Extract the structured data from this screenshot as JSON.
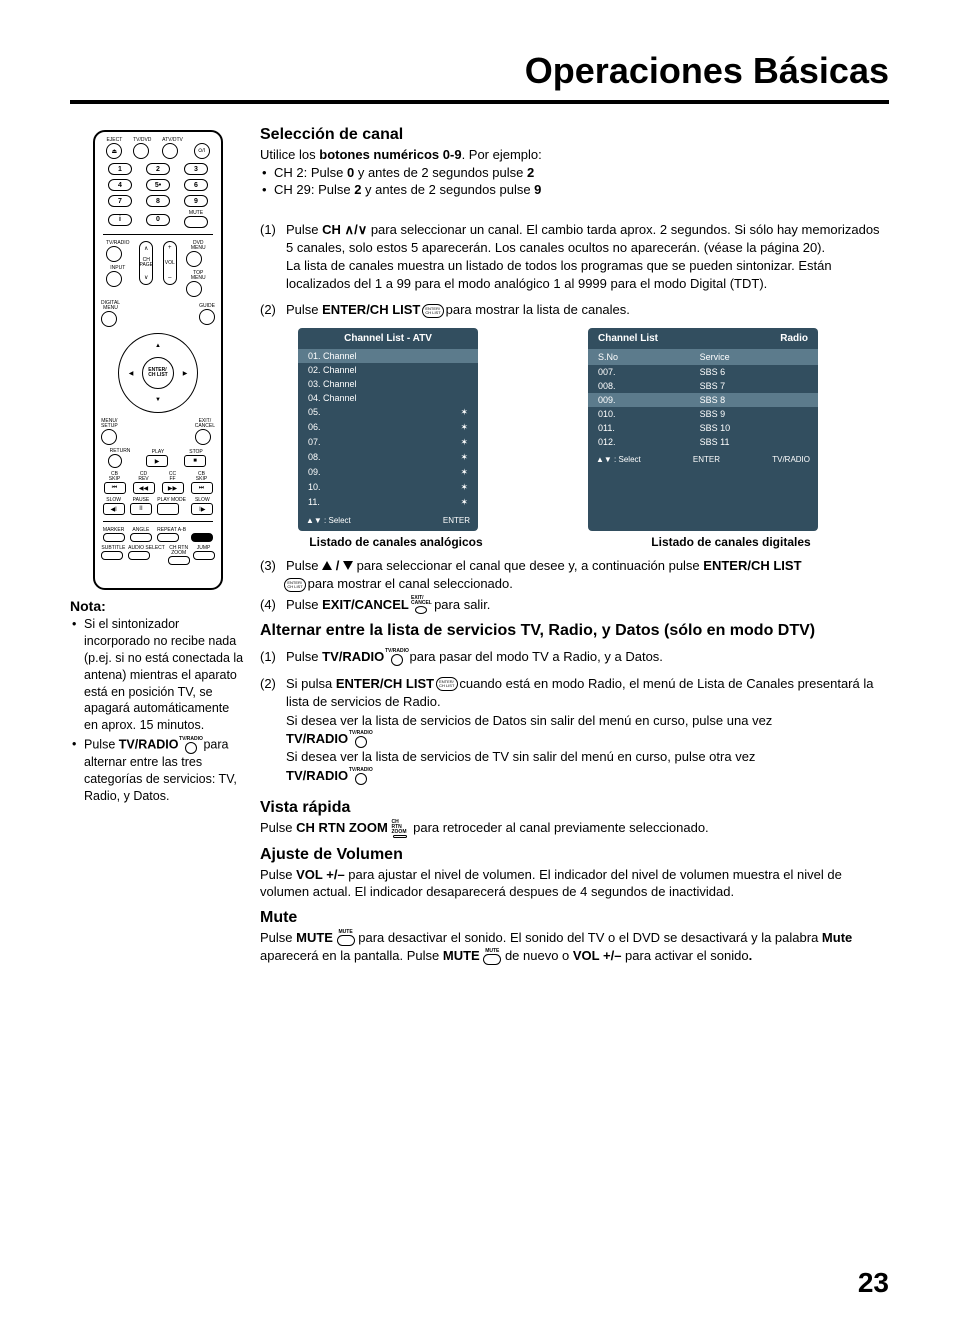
{
  "title": "Operaciones Básicas",
  "page_number": "23",
  "left": {
    "nota_heading": "Nota:",
    "notes": [
      "Si el sintonizador incorporado no recibe nada (p.ej. si no está conectada la antena) mientras el aparato está en posición TV, se apagará automáticamente en aprox. 15 minutos.",
      "Pulse TV/RADIO  para alternar entre las tres categorías de servicios: TV, Radio, y Datos."
    ],
    "note2_pre": "Pulse ",
    "note2_key": "TV/RADIO",
    "note2_post": " para alternar entre las tres categorías de servicios: TV, Radio, y Datos."
  },
  "remote": {
    "row_top_labels": [
      "EJECT",
      "TV/DVD",
      "ATV/DTV",
      ""
    ],
    "row_top_glyph": "⏏",
    "power_glyph": "⭘/I",
    "numbers": [
      "1",
      "2",
      "3",
      "4",
      "5•",
      "6",
      "7",
      "8",
      "9",
      "i",
      "0"
    ],
    "mute_label": "MUTE",
    "tvradio_label": "TV/RADIO",
    "dvdmenu_label": "DVD MENU",
    "input_label": "INPUT",
    "topmenu_label": "TOP MENU",
    "ch_page": "CH\nPAGE",
    "vol": "VOL",
    "digital_menu": "DIGITAL\nMENU",
    "guide": "GUIDE",
    "enter_chlist": "ENTER/\nCH LIST",
    "menu_setup": "MENU/\nSETUP",
    "exit_cancel": "EXIT/\nCANCEL",
    "return": "RETURN",
    "play": "PLAY",
    "stop": "STOP",
    "trick_row1": [
      "CB\nSKIP",
      "CD\nREV",
      "CC\nFF",
      "CB\nSKIP"
    ],
    "trick_row1_glyphs": [
      "⏮",
      "◀◀",
      "▶▶",
      "⏭"
    ],
    "trick_row2_labels": [
      "SLOW",
      "PAUSE",
      "PLAY MODE",
      "SLOW"
    ],
    "trick_row2_glyphs": [
      "◀I",
      "II",
      "",
      "I▶"
    ],
    "marker_row": [
      "MARKER",
      "ANGLE",
      "REPEAT A-B",
      ""
    ],
    "bottom_row": [
      "SUBTITLE",
      "AUDIO SELECT",
      "CH RTN\nZOOM",
      "JUMP"
    ]
  },
  "sec1": {
    "heading": "Selección de canal",
    "intro_pre": "Utilice los ",
    "intro_key": "botones numéricos 0-9",
    "intro_post": ". Por ejemplo:",
    "bullets": [
      "CH 2: Pulse 0 y antes de 2 segundos pulse 2",
      "CH 29: Pulse 2 y antes de 2 segundos pulse 9"
    ],
    "b1_pre": "CH 2: Pulse ",
    "b1_k1": "0",
    "b1_mid": " y antes de 2 segundos pulse ",
    "b1_k2": "2",
    "b2_pre": "CH 29: Pulse ",
    "b2_k1": "2",
    "b2_mid": " y antes de 2 segundos pulse ",
    "b2_k2": "9",
    "step1_num": "(1)",
    "step1_a": "Pulse ",
    "step1_key": "CH",
    "step1_b": " para seleccionar un canal. El cambio tarda aprox. 2 segundos. Si sólo hay memorizados 5 canales, solo estos 5 aparecerán. Los canales ocultos no aparecerán. (véase la página 20).",
    "step1_c": "La lista de canales muestra un listado de todos los programas que se pueden sintonizar. Están localizados del 1 a 99 para el modo analógico 1 al 9999 para el modo Digital (TDT).",
    "step2_num": "(2)",
    "step2_a": "Pulse ",
    "step2_key": "ENTER/CH LIST",
    "step2_b": " para mostrar la lista de canales.",
    "step3_num": "(3)",
    "step3_a": "Pulse ",
    "step3_mid": " para seleccionar el canal que desee y, a continuación pulse ",
    "step3_key2": "ENTER/CH LIST",
    "step3_c": " para mostrar el canal seleccionado.",
    "step4_num": "(4)",
    "step4_a": "Pulse ",
    "step4_key": "EXIT/CANCEL",
    "step4_b": " para salir."
  },
  "osd_analog": {
    "title": "Channel List - ATV",
    "rows": [
      "01. Channel",
      "02. Channel",
      "03. Channel",
      "04. Channel",
      "05.",
      "06.",
      "07.",
      "08.",
      "09.",
      "10.",
      "11."
    ],
    "highlight": 0,
    "footer_left": "▲▼ : Select",
    "footer_right": "ENTER",
    "caption": "Listado de canales analógicos"
  },
  "osd_digital": {
    "title_left": "Channel List",
    "title_right": "Radio",
    "th1": "S.No",
    "th2": "Service",
    "rows": [
      {
        "sno": "007.",
        "svc": "SBS 6"
      },
      {
        "sno": "008.",
        "svc": "SBS 7"
      },
      {
        "sno": "009.",
        "svc": "SBS 8"
      },
      {
        "sno": "010.",
        "svc": "SBS 9"
      },
      {
        "sno": "011.",
        "svc": "SBS 10"
      },
      {
        "sno": "012.",
        "svc": "SBS 11"
      }
    ],
    "highlight": 2,
    "footer_left": "▲▼ : Select",
    "footer_mid": "ENTER",
    "footer_right": "TV/RADIO",
    "caption": "Listado de canales digitales"
  },
  "sec2": {
    "heading": "Alternar entre la lista de servicios TV, Radio, y Datos (sólo en modo DTV)",
    "s1_num": "(1)",
    "s1_a": "Pulse ",
    "s1_key": "TV/RADIO",
    "s1_b": " para pasar del modo TV a Radio, y a Datos.",
    "s2_num": "(2)",
    "s2_a": "Si pulsa ",
    "s2_key": "ENTER/CH LIST",
    "s2_b": " cuando está en modo Radio, el menú de Lista de Canales presentará la lista de servicios de Radio.",
    "s2_c": "Si desea ver la lista de servicios de Datos sin salir del menú en curso, pulse una vez ",
    "s2_key2": "TV/RADIO",
    "s2_d": "Si desea ver la lista de servicios de TV sin salir del menú en curso, pulse otra vez ",
    "s2_key3": "TV/RADIO"
  },
  "sec3": {
    "heading": "Vista rápida",
    "a": "Pulse ",
    "key": "CH RTN ZOOM",
    "b": " para retroceder al canal previamente seleccionado."
  },
  "sec4": {
    "heading": "Ajuste de Volumen",
    "a": "Pulse ",
    "key": "VOL +/–",
    "b": " para ajustar el nivel de volumen. El indicador del nivel de volumen muestra el nivel de volumen actual. El indicador desaparecerá despues de 4 segundos de inactividad."
  },
  "sec5": {
    "heading": "Mute",
    "a": "Pulse ",
    "key1": "MUTE",
    "b": " para desactivar el sonido. El sonido del TV o el DVD se desactivará y la palabra ",
    "key2": "Mute",
    "c": " aparecerá en la pantalla. Pulse ",
    "key3": " MUTE ",
    "d": " de nuevo o ",
    "key4": "VOL +/–",
    "e": "  para activar el sonido",
    "f": "."
  }
}
